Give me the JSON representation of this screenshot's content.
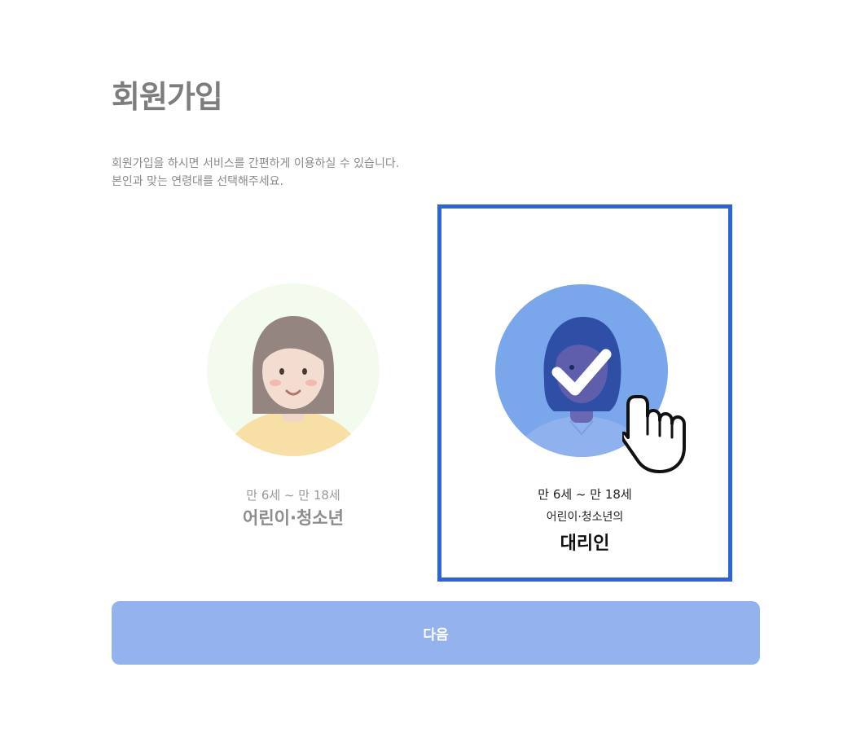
{
  "header": {
    "title": "회원가입"
  },
  "description": {
    "line1": "회원가입을 하시면 서비스를 간편하게 이용하실 수 있습니다.",
    "line2": "본인과 맞는 연령대를 선택해주세요."
  },
  "options": {
    "child": {
      "age_range": "만 6세 ~ 만 18세",
      "role": "어린이·청소년",
      "selected": false
    },
    "proxy": {
      "age_range": "만 6세 ~ 만 18세",
      "role_sub": "어린이·청소년의",
      "role": "대리인",
      "selected": true
    }
  },
  "footer": {
    "next_label": "다음"
  },
  "colors": {
    "selection_border": "#2f63d8",
    "next_button_bg": "#94b2ee",
    "proxy_avatar_bg": "#7aa6ec",
    "child_avatar_bg": "#f3fbee"
  },
  "icons": {
    "check": "check-icon",
    "pointer": "hand-pointer-icon"
  }
}
